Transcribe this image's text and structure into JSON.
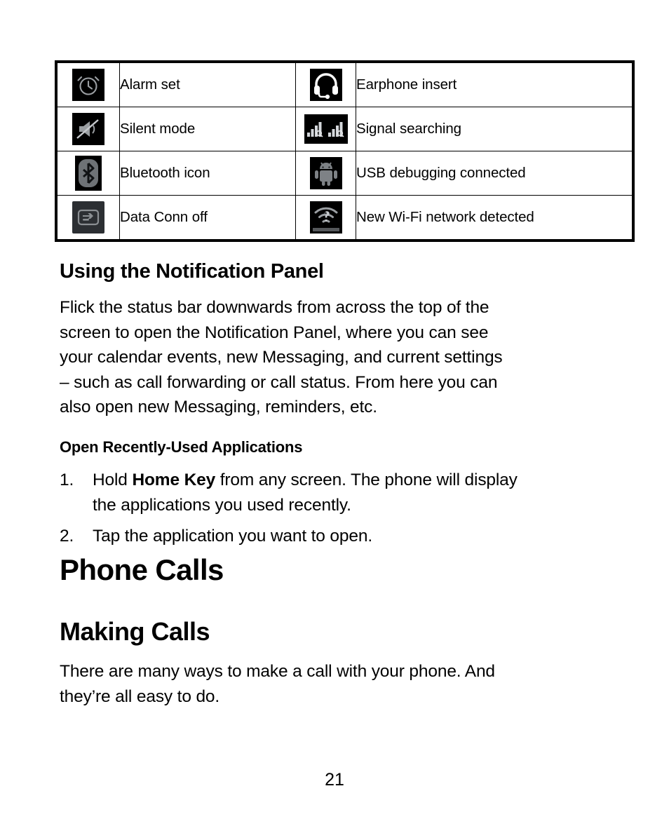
{
  "document": {
    "page_number": "21"
  },
  "status_icon_table": {
    "rows": [
      {
        "left_icon": "alarm-clock-icon",
        "left_label": "Alarm set",
        "right_icon": "headset-icon",
        "right_label": "Earphone insert"
      },
      {
        "left_icon": "speaker-muted-icon",
        "left_label": "Silent mode",
        "right_icon": "signal-searching-icon",
        "right_label": "Signal searching"
      },
      {
        "left_icon": "bluetooth-icon",
        "left_label": "Bluetooth icon",
        "right_icon": "android-robot-icon",
        "right_label": "USB debugging connected"
      },
      {
        "left_icon": "data-connection-off-icon",
        "left_label": "Data Conn off",
        "right_icon": "wifi-question-icon",
        "right_label": "New Wi-Fi network detected"
      }
    ]
  },
  "sections": {
    "notification_panel": {
      "heading": "Using the Notification Panel",
      "body": "Flick the status bar downwards from across the top of the\nscreen to open the Notification Panel, where you can see\nyour calendar events, new Messaging, and current settings\n– such as call forwarding or call status. From here you can\nalso open new Messaging, reminders, etc."
    },
    "recently_used": {
      "heading": "Open Recently-Used Applications",
      "items": [
        {
          "number": "1.",
          "text_before": "Hold ",
          "bold": "Home Key",
          "text_after": " from any screen. The phone will display\nthe applications you used recently."
        },
        {
          "number": "2.",
          "text_before": "Tap the application you want to open.",
          "bold": "",
          "text_after": ""
        }
      ]
    },
    "phone_calls": {
      "heading": "Phone Calls"
    },
    "making_calls": {
      "heading": "Making Calls",
      "body": "There are many ways to make a call with your phone. And\nthey’re all easy to do."
    }
  },
  "colors": {
    "text": "#000000",
    "page_background": "#ffffff",
    "icon_tile_dark": "#000000",
    "icon_tile_gray": "#2c2f33",
    "icon_glyph": "#b9bcc0"
  }
}
